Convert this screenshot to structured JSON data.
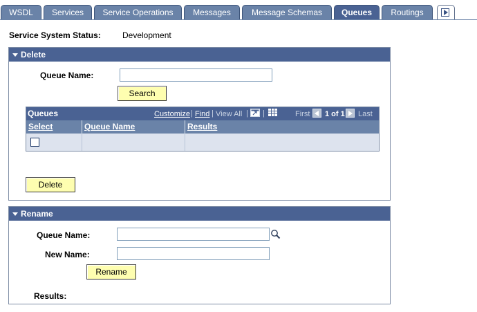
{
  "tabs": [
    {
      "label": "WSDL",
      "active": false
    },
    {
      "label": "Services",
      "active": false
    },
    {
      "label": "Service Operations",
      "active": false
    },
    {
      "label": "Messages",
      "active": false
    },
    {
      "label": "Message Schemas",
      "active": false
    },
    {
      "label": "Queues",
      "active": true
    },
    {
      "label": "Routings",
      "active": false
    }
  ],
  "status": {
    "label": "Service System Status:",
    "value": "Development"
  },
  "delete_section": {
    "title": "Delete",
    "queue_name_label": "Queue Name:",
    "queue_name_value": "",
    "search_button": "Search",
    "grid": {
      "title": "Queues",
      "customize": "Customize",
      "find": "Find",
      "view_all": "View All",
      "first": "First",
      "range": "1 of 1",
      "last": "Last",
      "columns": [
        "Select",
        "Queue Name",
        "Results"
      ],
      "rows": [
        {
          "select": false,
          "queue_name": "",
          "results": ""
        }
      ]
    },
    "delete_button": "Delete"
  },
  "rename_section": {
    "title": "Rename",
    "queue_name_label": "Queue Name:",
    "queue_name_value": "",
    "new_name_label": "New Name:",
    "new_name_value": "",
    "rename_button": "Rename",
    "results_label": "Results:"
  },
  "colors": {
    "header": "#4a6293",
    "tab": "#6a83a8",
    "button": "#fefeb0",
    "row": "#dde3ee"
  }
}
